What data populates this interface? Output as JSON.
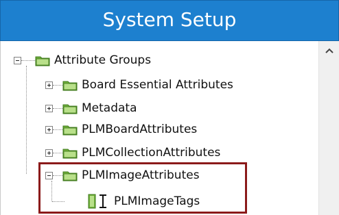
{
  "window": {
    "title": "System Setup"
  },
  "tree": {
    "root": {
      "label": "Attribute Groups",
      "expanded": true
    },
    "children": [
      {
        "label": "Board Essential Attributes",
        "expanded": false
      },
      {
        "label": "Metadata",
        "expanded": false
      },
      {
        "label": "PLMBoardAttributes",
        "expanded": false
      },
      {
        "label": "PLMCollectionAttributes",
        "expanded": false
      },
      {
        "label": "PLMImageAttributes",
        "expanded": true
      }
    ],
    "grandchild": {
      "label": "PLMImageTags"
    }
  },
  "colors": {
    "title_bar": "#1d80cf",
    "highlight_border": "#8b1a1a",
    "folder_green": "#6fae3a",
    "folder_light": "#b9e08a"
  },
  "icons": {
    "scroll_up": "chevron-up-icon",
    "folder": "folder-icon",
    "attribute": "attribute-icon"
  }
}
